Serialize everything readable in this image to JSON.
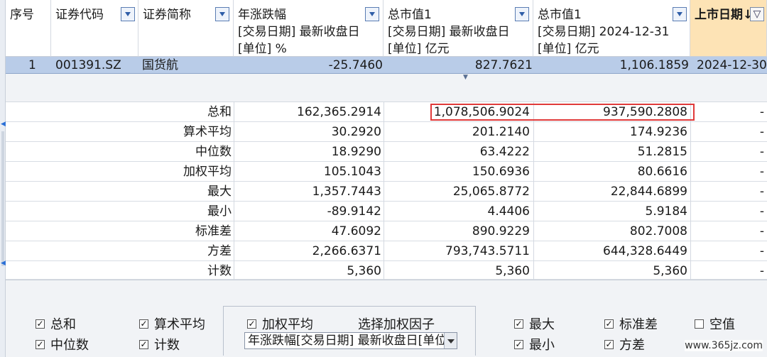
{
  "columns": {
    "seq": "序号",
    "code": "证券代码",
    "name": "证券简称",
    "col1": {
      "l1": "年涨跌幅",
      "l2": "[交易日期] 最新收盘日",
      "l3": "[单位] %"
    },
    "col2": {
      "l1": "总市值1",
      "l2": "[交易日期] 最新收盘日",
      "l3": "[单位] 亿元"
    },
    "col3": {
      "l1": "总市值1",
      "l2": "[交易日期] 2024-12-31",
      "l3": "[单位] 亿元"
    },
    "col4": {
      "l1": "上市日期↓"
    }
  },
  "row": {
    "seq": "1",
    "code": "001391.SZ",
    "name": "国货航",
    "v1": "-25.7460",
    "v2": "827.7621",
    "v3": "1,106.1859",
    "v4": "2024-12-30"
  },
  "stats": [
    {
      "label": "总和",
      "v1": "162,365.2914",
      "v2": "1,078,506.9024",
      "v3": "937,590.2808",
      "v4": "-"
    },
    {
      "label": "算术平均",
      "v1": "30.2920",
      "v2": "201.2140",
      "v3": "174.9236",
      "v4": "-"
    },
    {
      "label": "中位数",
      "v1": "18.9290",
      "v2": "63.4222",
      "v3": "51.2815",
      "v4": "-"
    },
    {
      "label": "加权平均",
      "v1": "105.1043",
      "v2": "150.6936",
      "v3": "80.6616",
      "v4": "-"
    },
    {
      "label": "最大",
      "v1": "1,357.7443",
      "v2": "25,065.8772",
      "v3": "22,844.6899",
      "v4": "-"
    },
    {
      "label": "最小",
      "v1": "-89.9142",
      "v2": "4.4406",
      "v3": "5.9184",
      "v4": "-"
    },
    {
      "label": "标准差",
      "v1": "47.6092",
      "v2": "890.9229",
      "v3": "802.7008",
      "v4": "-"
    },
    {
      "label": "方差",
      "v1": "2,266.6371",
      "v2": "793,743.5711",
      "v3": "644,328.6449",
      "v4": "-"
    },
    {
      "label": "计数",
      "v1": "5,360",
      "v2": "5,360",
      "v3": "5,360",
      "v4": "-"
    }
  ],
  "options": {
    "sum": "总和",
    "mean": "算术平均",
    "weighted": "加权平均",
    "choose_factor": "选择加权因子",
    "max": "最大",
    "std": "标准差",
    "empty": "空值",
    "median": "中位数",
    "count": "计数",
    "min": "最小",
    "variance": "方差",
    "factor_value": "年涨跌幅[交易日期] 最新收盘日[单位"
  },
  "watermark": "www.365jz.com",
  "colors": {
    "header_sorted": "#fde3b5",
    "selected_row": "#b9cce8",
    "highlight_border": "#e03a3a"
  }
}
